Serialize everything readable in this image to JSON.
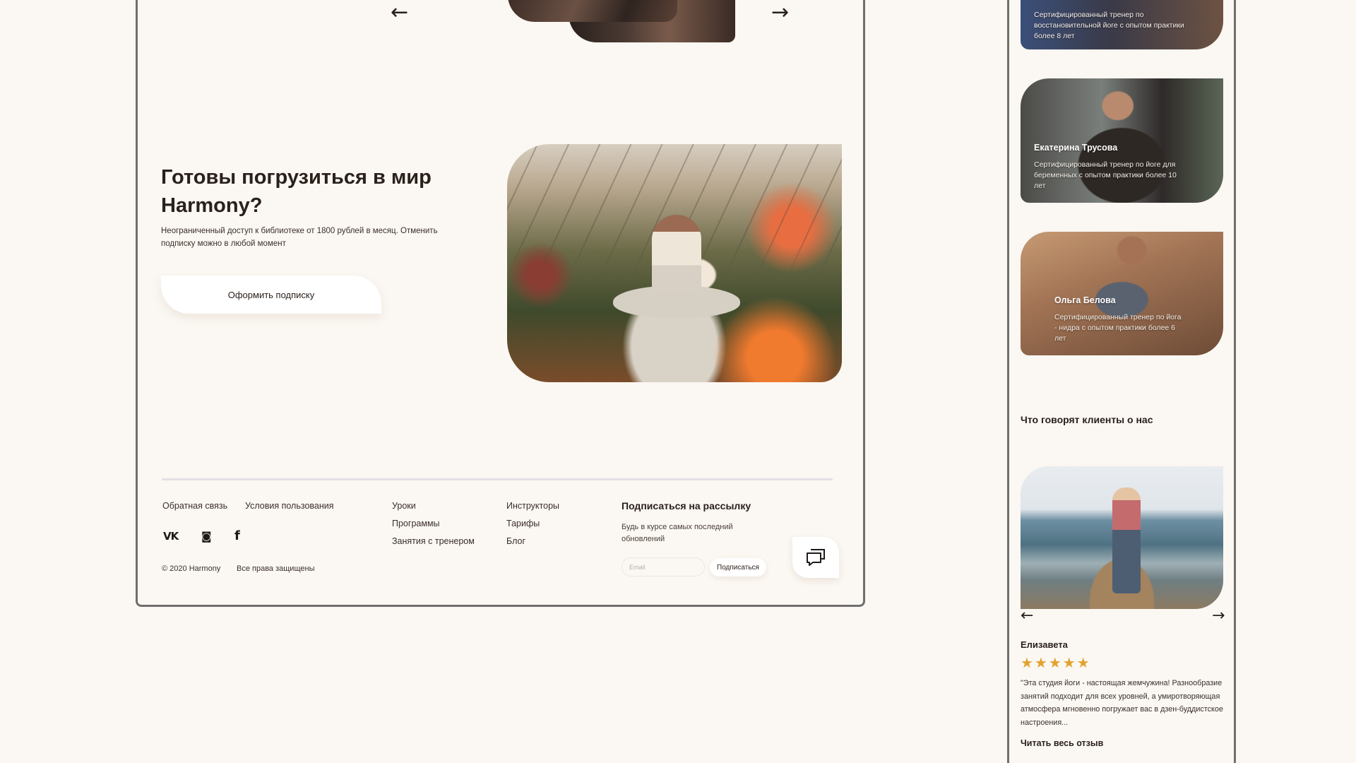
{
  "desktop": {
    "nav": {
      "prev_icon": "arrow-left-icon",
      "next_icon": "arrow-right-icon",
      "prev_glyph": "←",
      "next_glyph": "→"
    },
    "hero": {
      "title": "Готовы погрузиться в мир Harmony?",
      "text": "Неограниченный доступ к библиотеке от 1800 рублей в месяц. Отменить подписку можно в любой момент",
      "button": "Оформить подписку"
    },
    "footer": {
      "links_col1": [
        "Обратная связь",
        "Условия пользования"
      ],
      "links_col2": [
        "Уроки",
        "Программы",
        "Занятия с тренером"
      ],
      "links_col3": [
        "Инструкторы",
        "Тарифы",
        "Блог"
      ],
      "social": [
        "vk-icon",
        "instagram-icon",
        "facebook-icon"
      ],
      "social_glyphs": [
        "VK",
        "◙",
        "f"
      ],
      "copyright": "© 2020 Harmony",
      "rights": "Все права защищены",
      "newsletter": {
        "title": "Подписаться на рассылку",
        "text": "Будь в курсе самых последний обновлений",
        "placeholder": "Email",
        "button": "Подписаться"
      },
      "chat_icon": "chat-icon"
    }
  },
  "mobile": {
    "trainers": [
      {
        "name": "",
        "desc": "Сертифицированный тренер по восстановительной йоге с опытом практики более 8 лет"
      },
      {
        "name": "Екатерина Трусова",
        "desc": "Сертифицированный тренер по йоге для беременных с опытом практики более 10 лет"
      },
      {
        "name": "Ольга Белова",
        "desc": "Сертифицированный тренер по йога - нидра с опытом практики более 6 лет"
      }
    ],
    "reviews_title": "Что говорят клиенты о нас",
    "review": {
      "name": "Елизавета",
      "rating": 5,
      "stars": "★★★★★",
      "text": "\"Эта студия йоги - настоящая жемчужина! Разнообразие занятий подходит для всех уровней, а умиротворяющая атмосфера мгновенно погружает вас в дзен-буддистское настроения...",
      "read_more": "Читать весь отзыв"
    },
    "colors": {
      "accent": "#e2a22f",
      "background": "#fbf7f2",
      "text": "#2a211c"
    }
  }
}
